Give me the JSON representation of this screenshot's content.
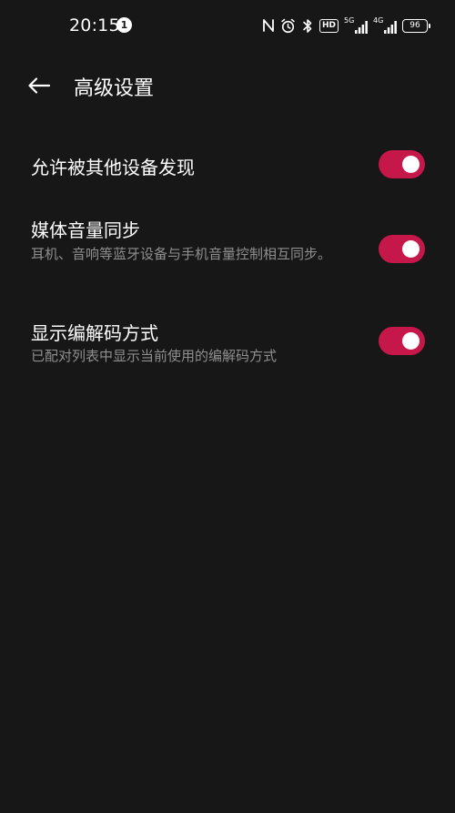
{
  "status_bar": {
    "time": "20:15",
    "notification_count": "1",
    "hd_label": "HD",
    "net1_label": "5G",
    "net2_label": "4G",
    "battery": "96"
  },
  "header": {
    "title": "高级设置"
  },
  "settings": [
    {
      "title": "允许被其他设备发现",
      "description": "",
      "enabled": true
    },
    {
      "title": "媒体音量同步",
      "description": "耳机、音响等蓝牙设备与手机音量控制相互同步。",
      "enabled": true
    },
    {
      "title": "显示编解码方式",
      "description": "已配对列表中显示当前使用的编解码方式",
      "enabled": true
    }
  ],
  "colors": {
    "background": "#171717",
    "toggle_on": "#c5174a",
    "secondary_text": "#8f8f8f"
  }
}
